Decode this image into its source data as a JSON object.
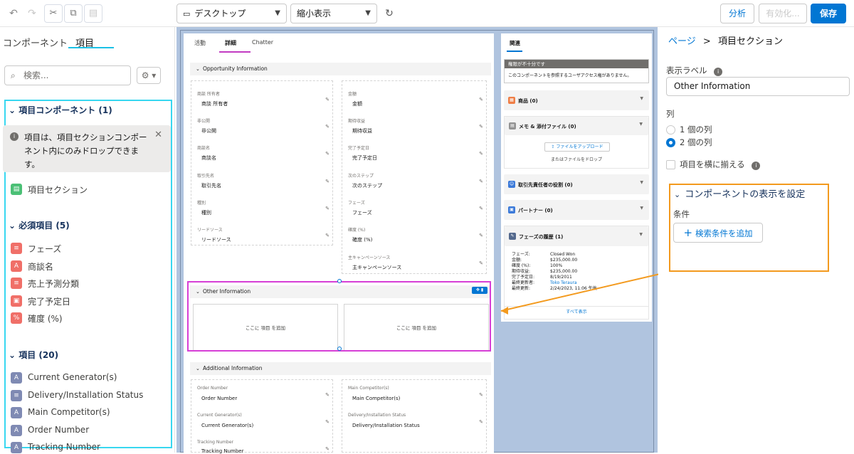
{
  "toolbar": {
    "undo": "↶",
    "redo": "↷",
    "cut": "✂",
    "copy": "⧉",
    "paste": "▤",
    "device_select": "デスクトップ",
    "view_select": "縮小表示",
    "analyze_label": "分析",
    "activate_label": "有効化...",
    "save_label": "保存"
  },
  "left": {
    "tabs": [
      "コンポーネント",
      "項目"
    ],
    "search_placeholder": "検索...",
    "field_components_header": "項目コンポーネント (1)",
    "info_text": "項目は、項目セクションコンポーネント内にのみドロップできます。",
    "field_section_label": "項目セクション",
    "required_header": "必須項目 (5)",
    "required_items": [
      {
        "label": "フェーズ",
        "icon": "list-icon",
        "color": "#f06f68"
      },
      {
        "label": "商談名",
        "icon": "text-icon",
        "color": "#f06f68"
      },
      {
        "label": "売上予測分類",
        "icon": "list-icon",
        "color": "#f06f68"
      },
      {
        "label": "完了予定日",
        "icon": "calendar-icon",
        "color": "#f06f68"
      },
      {
        "label": "確度 (%)",
        "icon": "percent-icon",
        "color": "#f06f68"
      }
    ],
    "fields_header": "項目 (20)",
    "field_items": [
      {
        "label": "Current Generator(s)",
        "icon": "text-icon",
        "color": "#7f8ab3"
      },
      {
        "label": "Delivery/Installation Status",
        "icon": "list-icon",
        "color": "#7f8ab3"
      },
      {
        "label": "Main Competitor(s)",
        "icon": "text-icon",
        "color": "#7f8ab3"
      },
      {
        "label": "Order Number",
        "icon": "text-icon",
        "color": "#7f8ab3"
      },
      {
        "label": "Tracking Number",
        "icon": "text-icon",
        "color": "#7f8ab3"
      }
    ]
  },
  "canvas": {
    "tabs": [
      "活動",
      "詳細",
      "Chatter"
    ],
    "section1_title": "Opportunity Information",
    "left_fields": [
      {
        "label": "商談 所有者",
        "value": "商談 所有者"
      },
      {
        "label": "非公開",
        "value": "非公開"
      },
      {
        "label": "商談名",
        "value": "商談名"
      },
      {
        "label": "取引先名",
        "value": "取引先名"
      },
      {
        "label": "種別",
        "value": "種別"
      },
      {
        "label": "リードソース",
        "value": "リードソース"
      }
    ],
    "right_fields": [
      {
        "label": "金額",
        "value": "金額"
      },
      {
        "label": "期待収益",
        "value": "期待収益"
      },
      {
        "label": "完了予定日",
        "value": "完了予定日"
      },
      {
        "label": "次のステップ",
        "value": "次のステップ"
      },
      {
        "label": "フェーズ",
        "value": "フェーズ"
      },
      {
        "label": "確度 (%)",
        "value": "確度 (%)"
      },
      {
        "label": "主キャンペーンソース",
        "value": "主キャンペーンソース"
      }
    ],
    "section2_title": "Other Information",
    "drop_text": "ここに 項目 を追加",
    "section3_title": "Additional Information",
    "add_left": [
      {
        "label": "Order Number",
        "value": "Order Number"
      },
      {
        "label": "Current Generator(s)",
        "value": "Current Generator(s)"
      },
      {
        "label": "Tracking Number",
        "value": "Tracking Number"
      }
    ],
    "add_right": [
      {
        "label": "Main Competitor(s)",
        "value": "Main Competitor(s)"
      },
      {
        "label": "Delivery/Installation Status",
        "value": "Delivery/Installation Status"
      }
    ]
  },
  "related": {
    "tab": "関連",
    "perm_title": "権限が不十分です",
    "perm_text": "このコンポーネントを参照するユーザアクセス権がありません。",
    "products": "商品 (0)",
    "notes": "メモ & 添付ファイル (0)",
    "upload_btn": "ファイルをアップロード",
    "drop_files": "またはファイルをドロップ",
    "contact_roles": "取引先責任者の役割 (0)",
    "partners": "パートナー (0)",
    "stage_history": "フェーズの履歴 (1)",
    "history_rows": [
      {
        "k": "フェーズ:",
        "v": "Closed Won"
      },
      {
        "k": "金額:",
        "v": "$235,000.00"
      },
      {
        "k": "確度 (%):",
        "v": "100%"
      },
      {
        "k": "期待収益:",
        "v": "$235,000.00"
      },
      {
        "k": "完了予定日:",
        "v": "8/19/2011"
      },
      {
        "k": "最終更新者:",
        "v": "Toko Teraura"
      },
      {
        "k": "最終更新:",
        "v": "2/24/2023, 11:06 午後"
      }
    ],
    "view_all": "すべて表示"
  },
  "right": {
    "breadcrumb_page": "ページ",
    "breadcrumb_sep": ">",
    "breadcrumb_current": "項目セクション",
    "label_title": "表示ラベル",
    "label_value": "Other Information",
    "columns_title": "列",
    "col1": "1 個の列",
    "col2": "2 個の列",
    "align_label": "項目を横に揃える",
    "visibility_header": "コンポーネントの表示を設定",
    "conditions_label": "条件",
    "add_filter": "検索条件を追加"
  },
  "colors": {
    "brand": "#0176d3",
    "cyan_highlight": "#38d7f0",
    "magenta_highlight": "#d63fd6",
    "orange_highlight": "#f39a1e"
  }
}
